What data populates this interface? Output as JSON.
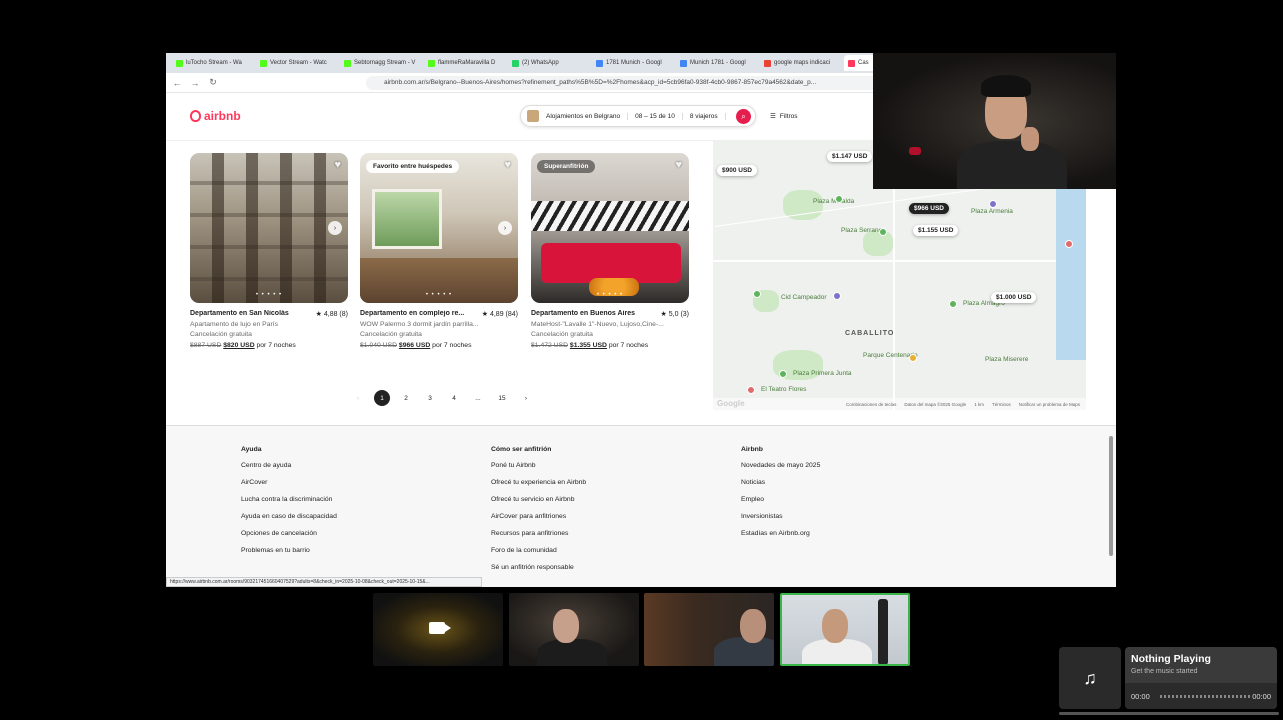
{
  "browser": {
    "tabs": [
      {
        "label": "luTocho Stream - Wa",
        "color": "#53fc18"
      },
      {
        "label": "Vector Stream - Watc",
        "color": "#53fc18"
      },
      {
        "label": "Sebtornagg Stream - V",
        "color": "#53fc18"
      },
      {
        "label": "flammeRaMaravilla D",
        "color": "#53fc18"
      },
      {
        "label": "(2) WhatsApp",
        "color": "#25d366"
      },
      {
        "label": "1781 Munich - Googl",
        "color": "#4285f4"
      },
      {
        "label": "Munich 1781 - Googl",
        "color": "#4285f4"
      },
      {
        "label": "google maps indicaci",
        "color": "#ea4335"
      },
      {
        "label": "Cas",
        "color": "#ff385c"
      }
    ],
    "url": "airbnb.com.ar/s/Belgrano--Buenos-Aires/homes?refinement_paths%5B%5D=%2Fhomes&acp_id=5cb96fa0-938f-4cb0-9867-857ec79a4562&date_p..."
  },
  "header": {
    "logo": "airbnb",
    "search": {
      "location": "Alojamientos en Belgrano",
      "dates": "08 – 15 de 10",
      "guests": "8 viajeros"
    },
    "filters_label": "Filtros"
  },
  "listings": [
    {
      "badge": "",
      "title": "Departamento en San Nicolás",
      "rating": "★ 4,88 (8)",
      "subtitle": "Apartamento de lujo en París",
      "cancellation": "Cancelación gratuita",
      "old_price": "$887 USD",
      "price": "$820 USD",
      "price_suffix": "por 7 noches"
    },
    {
      "badge": "Favorito entre huéspedes",
      "title": "Departamento en complejo re...",
      "rating": "★ 4,89 (84)",
      "subtitle": "WOW Palermo 3 dormit jardín parrilla...",
      "cancellation": "Cancelación gratuita",
      "old_price": "$1.040 USD",
      "price": "$966 USD",
      "price_suffix": "por 7 noches"
    },
    {
      "badge": "Superanfitrión",
      "title": "Departamento en Buenos Aires",
      "rating": "★ 5,0 (3)",
      "subtitle": "MateHost-\"Lavalle 1\"-Nuevo, Lujoso,Cine-...",
      "cancellation": "Cancelación gratuita",
      "old_price": "$1.472 USD",
      "price": "$1.355 USD",
      "price_suffix": "por 7 noches"
    }
  ],
  "pagination": {
    "prev": "‹",
    "pages": [
      "1",
      "2",
      "3",
      "4",
      "...",
      "15"
    ],
    "next": "›",
    "current": "1"
  },
  "map": {
    "price_tags": [
      "$900 USD",
      "$1.147 USD",
      "$966 USD",
      "$1.155 USD",
      "$1.000 USD"
    ],
    "labels": [
      "Plaza Mafalda",
      "Plaza Serrano",
      "Plaza Armenia",
      "Cid Campeador",
      "Plaza Almagro",
      "CABALLITO",
      "Plaza Miserere",
      "Plaza Primera Junta",
      "El Teatro Flores",
      "Parque Centenario"
    ],
    "google": "Google",
    "attribution": [
      "Combinaciones de teclas",
      "Datos del mapa ©2025 Google",
      "1 km",
      "Términos",
      "Notificar un problema de Maps"
    ]
  },
  "footer": {
    "columns": [
      {
        "heading": "Ayuda",
        "links": [
          "Centro de ayuda",
          "AirCover",
          "Lucha contra la discriminación",
          "Ayuda en caso de discapacidad",
          "Opciones de cancelación",
          "Problemas en tu barrio"
        ]
      },
      {
        "heading": "Cómo ser anfitrión",
        "links": [
          "Poné tu Airbnb",
          "Ofrecé tu experiencia en Airbnb",
          "Ofrecé tu servicio en Airbnb",
          "AirCover para anfitriones",
          "Recursos para anfitriones",
          "Foro de la comunidad",
          "Sé un anfitrión responsable"
        ]
      },
      {
        "heading": "Airbnb",
        "links": [
          "Novedades de mayo 2025",
          "Noticias",
          "Empleo",
          "Inversionistas",
          "Estadías en Airbnb.org"
        ]
      }
    ],
    "status_url": "https://www.airbnb.com.ar/rooms/903217451660407529?adults=8&check_in=2025-10-08&check_out=2025-10-15&..."
  },
  "music": {
    "title": "Nothing Playing",
    "subtitle": "Get the music started",
    "time_start": "00:00",
    "time_end": "00:00"
  },
  "colors": {
    "brand": "#ff385c",
    "active_speaker": "#39b54a"
  }
}
